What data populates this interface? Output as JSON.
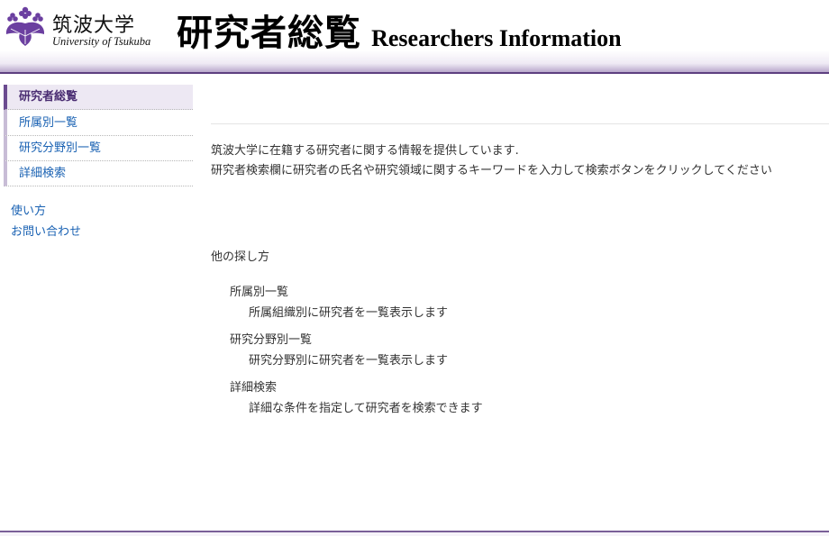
{
  "header": {
    "logo_jp": "筑波大学",
    "logo_en": "University of Tsukuba",
    "title_jp": "研究者総覧",
    "title_en": "Researchers Information",
    "brand_color": "#5d3f80"
  },
  "sidebar": {
    "nav": [
      {
        "label": "研究者総覧",
        "active": true
      },
      {
        "label": "所属別一覧",
        "active": false
      },
      {
        "label": "研究分野別一覧",
        "active": false
      },
      {
        "label": "詳細検索",
        "active": false
      }
    ],
    "links": [
      "使い方",
      "お問い合わせ"
    ]
  },
  "main": {
    "intro_line1": "筑波大学に在籍する研究者に関する情報を提供しています.",
    "intro_line2": "研究者検索欄に研究者の氏名や研究領域に関するキーワードを入力して検索ボタンをクリックしてください",
    "other_title": "他の探し方",
    "methods": [
      {
        "term": "所属別一覧",
        "desc": "所属組織別に研究者を一覧表示します"
      },
      {
        "term": "研究分野別一覧",
        "desc": "研究分野別に研究者を一覧表示します"
      },
      {
        "term": "詳細検索",
        "desc": "詳細な条件を指定して研究者を検索できます"
      }
    ]
  },
  "icons": {
    "logo_mark": "paulownia-crest-icon"
  }
}
